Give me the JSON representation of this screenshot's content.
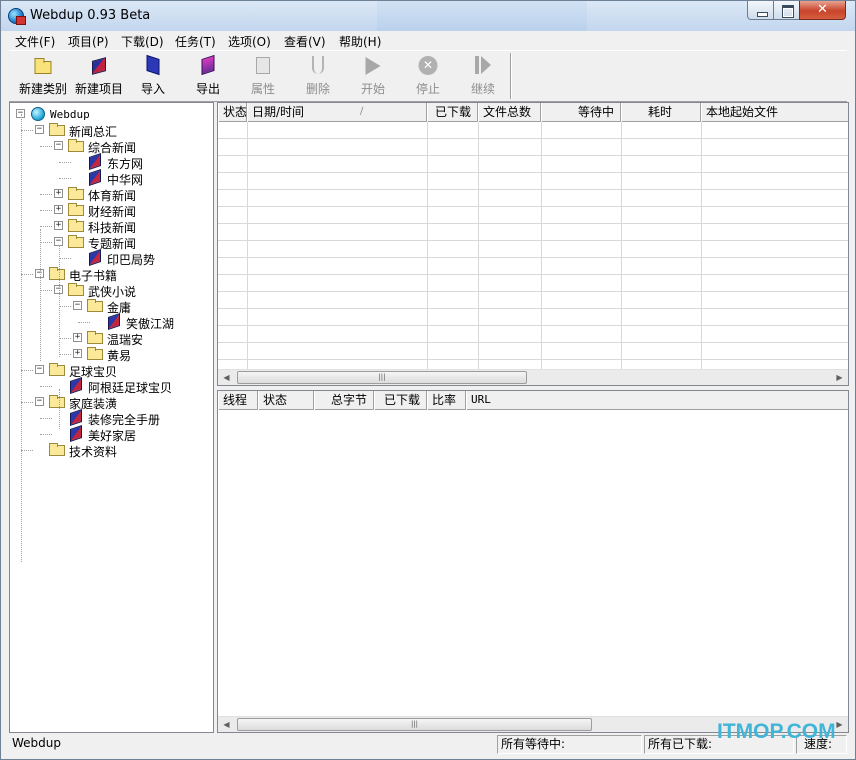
{
  "window": {
    "title": "Webdup 0.93 Beta",
    "close_glyph": "✕"
  },
  "menu": [
    "文件(F)",
    "项目(P)",
    "下载(D)",
    "任务(T)",
    "选项(O)",
    "查看(V)",
    "帮助(H)"
  ],
  "toolbar": {
    "buttons": [
      {
        "label": "新建类别",
        "icon": "folder-icon",
        "enabled": true
      },
      {
        "label": "新建项目",
        "icon": "books-icon",
        "enabled": true
      },
      {
        "label": "导入",
        "icon": "import-icon",
        "enabled": true
      },
      {
        "label": "导出",
        "icon": "export-icon",
        "enabled": true
      },
      {
        "label": "属性",
        "icon": "properties-icon",
        "enabled": false
      },
      {
        "label": "删除",
        "icon": "scissors-icon",
        "enabled": false
      },
      {
        "label": "开始",
        "icon": "play-icon",
        "enabled": false
      },
      {
        "label": "停止",
        "icon": "stop-icon",
        "enabled": false,
        "glyph": "✕"
      },
      {
        "label": "继续",
        "icon": "resume-icon",
        "enabled": false
      }
    ]
  },
  "tree": {
    "root": "Webdup",
    "nodes": [
      {
        "label": "新闻总汇",
        "type": "folder",
        "expanded": true
      },
      {
        "label": "综合新闻",
        "type": "folder",
        "expanded": true
      },
      {
        "label": "东方网",
        "type": "book"
      },
      {
        "label": "中华网",
        "type": "book"
      },
      {
        "label": "体育新闻",
        "type": "folder",
        "expanded": false
      },
      {
        "label": "财经新闻",
        "type": "folder",
        "expanded": false
      },
      {
        "label": "科技新闻",
        "type": "folder",
        "expanded": false
      },
      {
        "label": "专题新闻",
        "type": "folder",
        "expanded": true
      },
      {
        "label": "印巴局势",
        "type": "book"
      },
      {
        "label": "电子书籍",
        "type": "folder",
        "expanded": true
      },
      {
        "label": "武侠小说",
        "type": "folder",
        "expanded": true
      },
      {
        "label": "金庸",
        "type": "folder",
        "expanded": true
      },
      {
        "label": "笑傲江湖",
        "type": "book"
      },
      {
        "label": "温瑞安",
        "type": "folder",
        "expanded": false
      },
      {
        "label": "黄易",
        "type": "folder",
        "expanded": false
      },
      {
        "label": "足球宝贝",
        "type": "folder",
        "expanded": true
      },
      {
        "label": "阿根廷足球宝贝",
        "type": "book"
      },
      {
        "label": "家庭装潢",
        "type": "folder",
        "expanded": true
      },
      {
        "label": "装修完全手册",
        "type": "book"
      },
      {
        "label": "美好家居",
        "type": "book"
      },
      {
        "label": "技术资料",
        "type": "folder"
      }
    ],
    "expand_glyph": "+",
    "collapse_glyph": "−"
  },
  "task_list": {
    "columns": [
      "状态",
      "日期/时间",
      "已下载",
      "文件总数",
      "等待中",
      "耗时",
      "本地起始文件"
    ],
    "sort_glyph": "∕",
    "rows": []
  },
  "thread_list": {
    "columns": [
      "线程",
      "状态",
      "总字节",
      "已下载",
      "比率",
      "URL"
    ],
    "rows": []
  },
  "scroll": {
    "left_arrow": "◀",
    "right_arrow": "▶",
    "grip": "|||"
  },
  "statusbar": {
    "app": "Webdup",
    "waiting_label": "所有等待中:",
    "downloaded_label": "所有已下载:",
    "speed_label": "速度:",
    "watermark": "ITMOP.COM"
  }
}
